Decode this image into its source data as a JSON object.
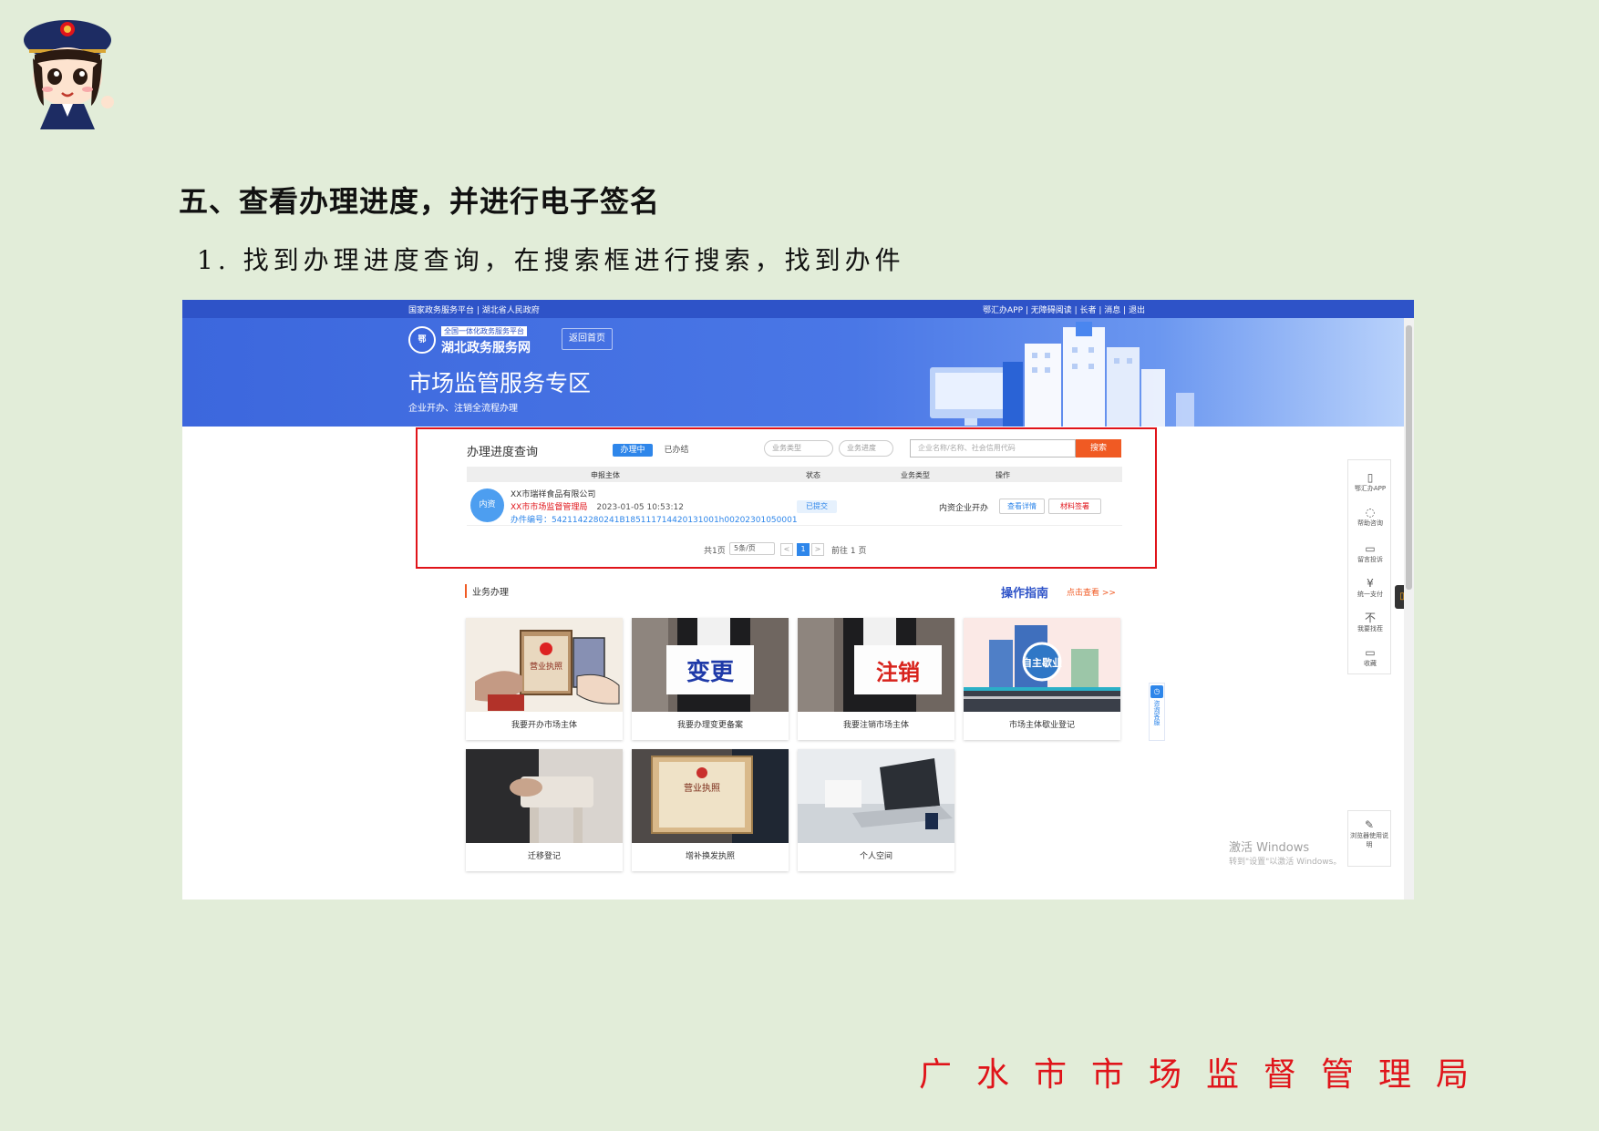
{
  "section_title": "五、查看办理进度，并进行电子签名",
  "step_text": "1. 找到办理进度查询，在搜索框进行搜索，找到办件",
  "footer_org": "广水市市场监督管理局",
  "portal": {
    "topbar_left": "国家政务服务平台 | 湖北省人民政府",
    "topbar_right": "鄂汇办APP | 无障碍阅读 | 长者 | 消息 | 退出",
    "logo_badge": "鄂",
    "logo_sub": "全国一体化政务服务平台",
    "logo_main": "湖北政务服务网",
    "back_home": "返回首页",
    "hero_title": "市场监管服务专区",
    "hero_sub": "企业开办、注销全流程办理"
  },
  "query": {
    "title": "办理进度查询",
    "tab_active": "办理中",
    "tab_done": "已办结",
    "select1": "业务类型",
    "select2": "业务进度",
    "search_placeholder": "企业名称/名称、社会信用代码",
    "search_button": "搜索",
    "headers": [
      "申报主体",
      "状态",
      "业务类型",
      "操作"
    ],
    "row": {
      "avatar": "内资",
      "company": "XX市瑞祥食品有限公司",
      "biz_label": "XX市市场监督管理局",
      "datetime": "2023-01-05 10:53:12",
      "biz_no": "办件编号：5421142280241B185111714420131001h00202301050001",
      "status": "已提交",
      "type": "内资企业开办",
      "op1": "查看详情",
      "op2": "材料签署"
    },
    "pager": {
      "total": "共1页",
      "size": "5条/页",
      "prev": "<",
      "current": "1",
      "next": ">",
      "goto": "前往  1  页"
    }
  },
  "business": {
    "title": "业务办理",
    "guide_title": "操作指南",
    "guide_link": "点击查看 >>",
    "cards": [
      "我要开办市场主体",
      "我要办理变更备案",
      "我要注销市场主体",
      "市场主体歇业登记",
      "迁移登记",
      "增补换发执照",
      "个人空间"
    ],
    "card_words": [
      "营业执照",
      "变更",
      "注销",
      "自主歇业",
      "营业执照"
    ]
  },
  "float_bar": [
    {
      "icon": "▯",
      "label": "鄂汇办APP"
    },
    {
      "icon": "◌",
      "label": "帮助咨询"
    },
    {
      "icon": "▭",
      "label": "留言投诉"
    },
    {
      "icon": "¥",
      "label": "统一支付"
    },
    {
      "icon": "不",
      "label": "我要找茬"
    },
    {
      "icon": "▭",
      "label": "收藏"
    }
  ],
  "consult": "咨询客服",
  "browser_tip": "浏览器使用说明",
  "win_activate": "激活 Windows",
  "win_activate_sub": "转到\"设置\"以激活 Windows。",
  "colors": {
    "page_bg": "#e2edd9",
    "header_blue": "#3c67dd",
    "highlight_red": "#e0141a",
    "search_orange": "#f05a23",
    "link_blue": "#2e86ea"
  }
}
